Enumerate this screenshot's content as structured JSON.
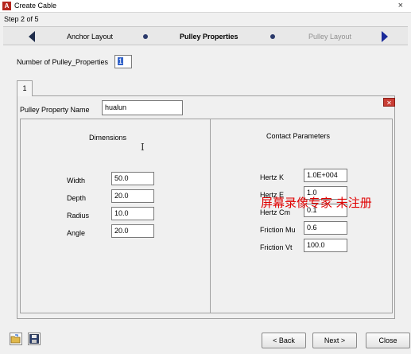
{
  "window": {
    "title": "Create Cable",
    "close": "×"
  },
  "step": "Step 2 of 5",
  "nav": {
    "prev": "Anchor Layout",
    "current": "Pulley Properties",
    "next": "Pulley Layout"
  },
  "count": {
    "label": "Number of Pulley_Properties",
    "value": "1"
  },
  "tabs": [
    "1"
  ],
  "property_name": {
    "label": "Pulley Property Name",
    "value": "hualun"
  },
  "dimensions": {
    "title": "Dimensions",
    "fields": [
      {
        "label": "Width",
        "value": "50.0"
      },
      {
        "label": "Depth",
        "value": "20.0"
      },
      {
        "label": "Radius",
        "value": "10.0"
      },
      {
        "label": "Angle",
        "value": "20.0"
      }
    ]
  },
  "contact": {
    "title": "Contact Parameters",
    "fields": [
      {
        "label": "Hertz K",
        "value": "1.0E+004"
      },
      {
        "label": "Hertz E",
        "value": "1.0"
      },
      {
        "label": "Hertz Cm",
        "value": "0.1"
      },
      {
        "label": "Friction Mu",
        "value": "0.6"
      },
      {
        "label": "Friction Vt",
        "value": "100.0"
      }
    ]
  },
  "watermark": "屏幕录像专家  未注册",
  "buttons": {
    "back": "< Back",
    "next": "Next >",
    "close": "Close"
  },
  "colors": {
    "close_button": "#c93e35",
    "nav_arrow": "#1f2d4b",
    "selection": "#3363c9",
    "watermark": "#e00000"
  }
}
